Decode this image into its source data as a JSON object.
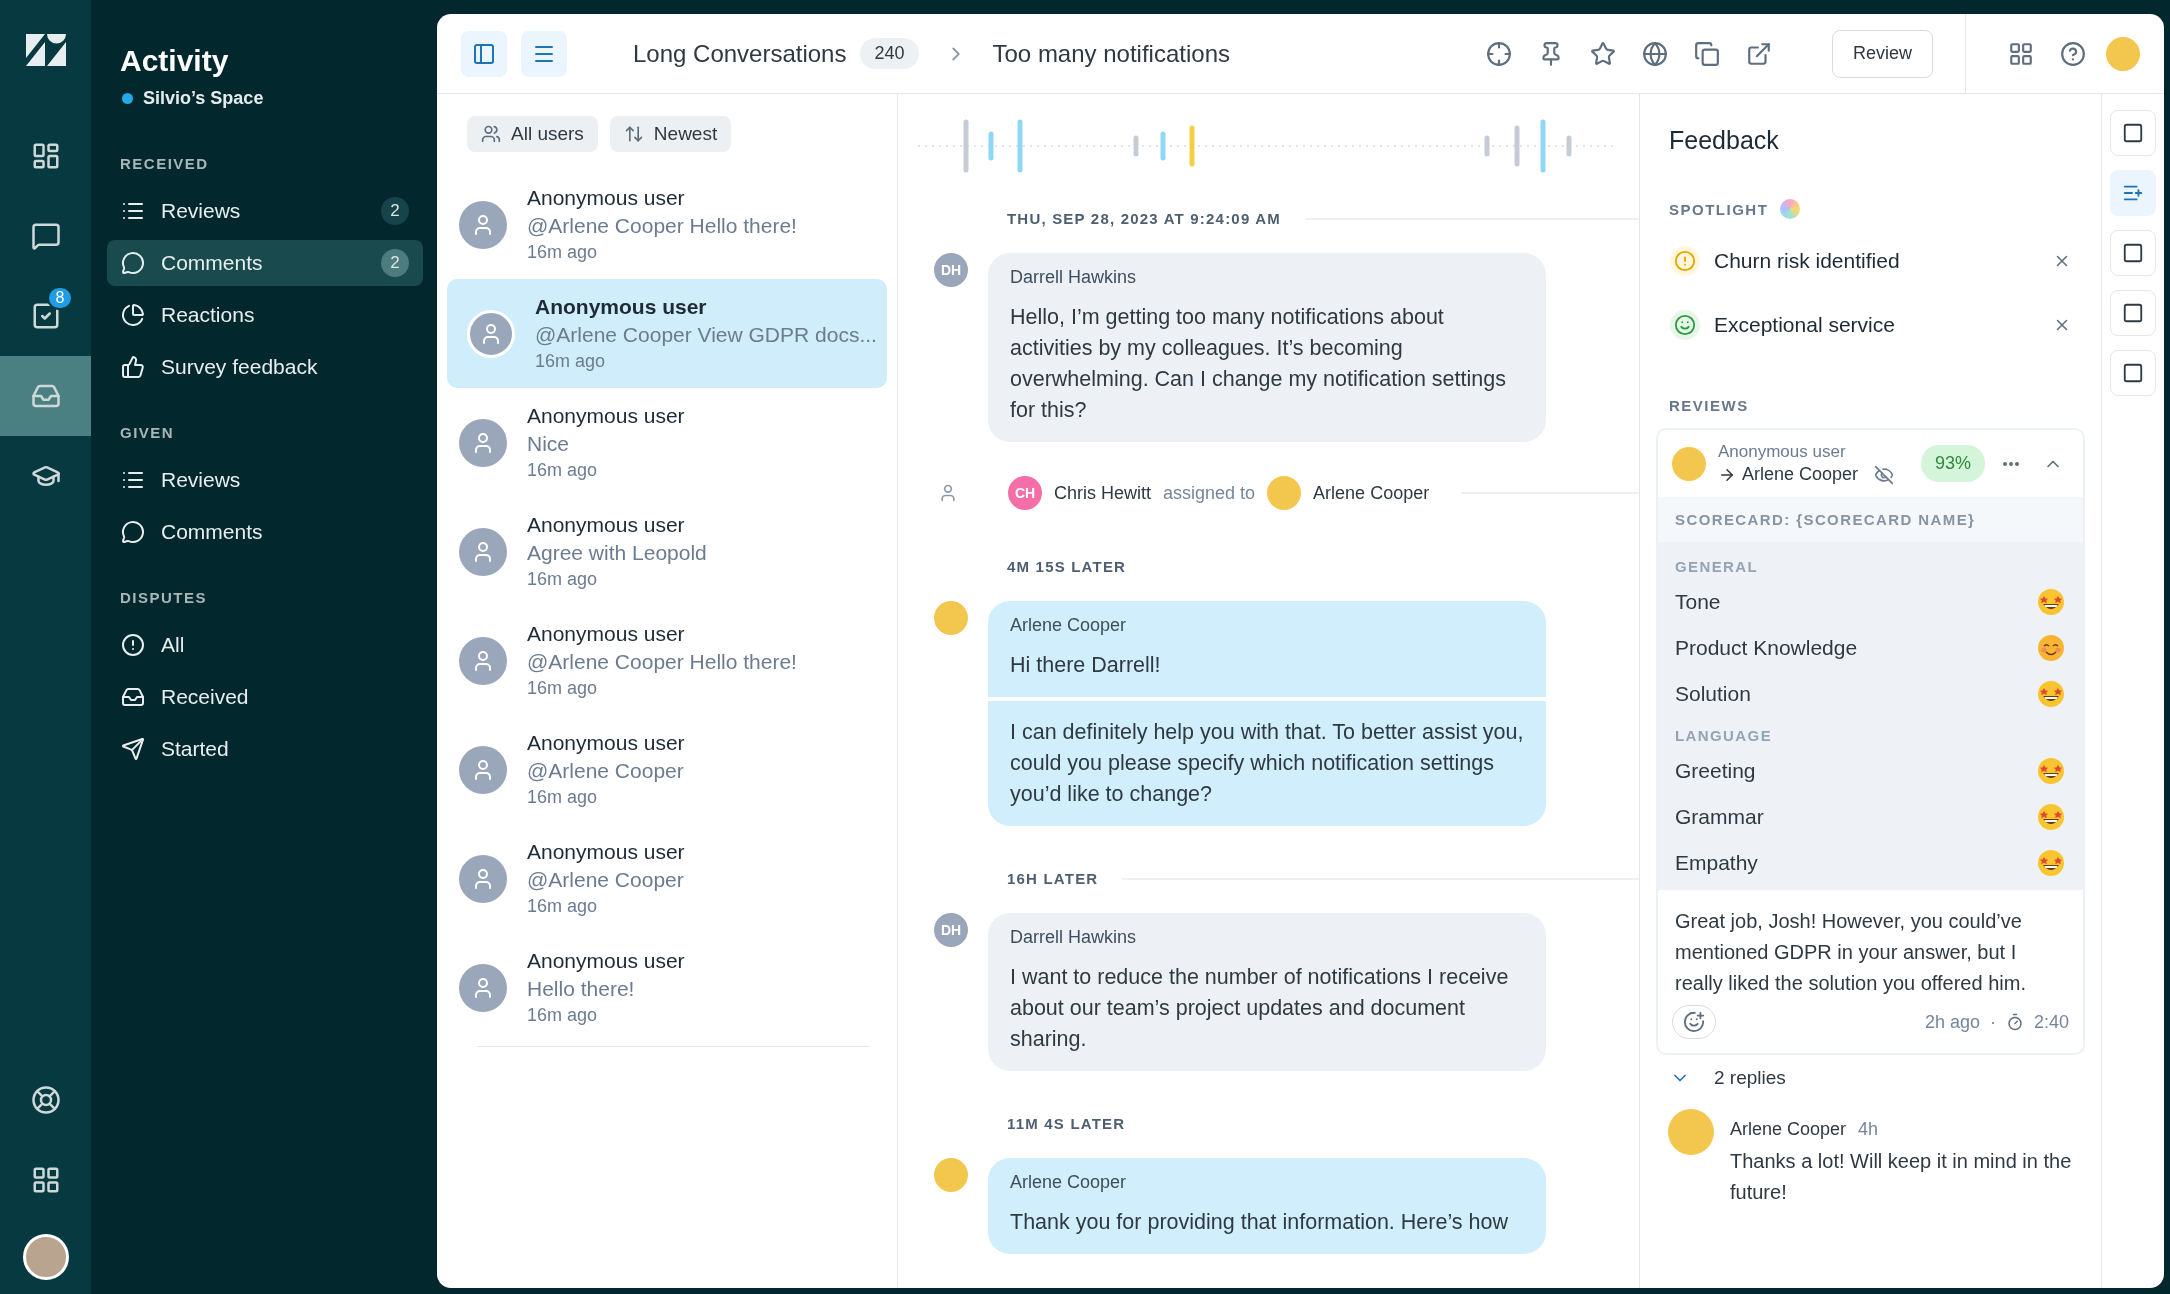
{
  "rail": {
    "top": [
      {
        "kind": "dashboard",
        "selected": false
      },
      {
        "kind": "chat",
        "selected": false
      },
      {
        "kind": "tasks",
        "selected": false,
        "badge": "8"
      },
      {
        "kind": "inbox",
        "selected": true
      },
      {
        "kind": "learn",
        "selected": false
      }
    ],
    "bottom": [
      {
        "kind": "help",
        "selected": false
      },
      {
        "kind": "apps",
        "selected": false
      }
    ]
  },
  "nav": {
    "title": "Activity",
    "space": "Silvio’s Space",
    "sections": [
      {
        "heading": "RECEIVED",
        "items": [
          {
            "kind": "reviews",
            "label": "Reviews",
            "count": "2",
            "selected": false
          },
          {
            "kind": "comments",
            "label": "Comments",
            "count": "2",
            "selected": true
          },
          {
            "kind": "reactions",
            "label": "Reactions",
            "selected": false
          },
          {
            "kind": "survey",
            "label": "Survey feedback",
            "selected": false
          }
        ]
      },
      {
        "heading": "GIVEN",
        "items": [
          {
            "kind": "reviews",
            "label": "Reviews",
            "selected": false
          },
          {
            "kind": "comments",
            "label": "Comments",
            "selected": false
          }
        ]
      },
      {
        "heading": "DISPUTES",
        "items": [
          {
            "kind": "all",
            "label": "All",
            "selected": false
          },
          {
            "kind": "received",
            "label": "Received",
            "selected": false
          },
          {
            "kind": "started",
            "label": "Started",
            "selected": false
          }
        ]
      }
    ]
  },
  "header": {
    "parent": "Long Conversations",
    "count": "240",
    "current": "Too many notifications",
    "review_button": "Review"
  },
  "filters": [
    {
      "kind": "users",
      "label": "All users"
    },
    {
      "kind": "sort",
      "label": "Newest"
    }
  ],
  "conversations": [
    {
      "name": "Anonymous user",
      "preview": "@Arlene Cooper Hello there!",
      "time": "16m ago",
      "selected": false
    },
    {
      "name": "Anonymous user",
      "preview": "@Arlene Cooper View GDPR docs...",
      "time": "16m ago",
      "selected": true
    },
    {
      "name": "Anonymous user",
      "preview": "Nice",
      "time": "16m ago",
      "selected": false
    },
    {
      "name": "Anonymous user",
      "preview": "Agree with Leopold",
      "time": "16m ago",
      "selected": false
    },
    {
      "name": "Anonymous user",
      "preview": "@Arlene Cooper Hello there!",
      "time": "16m ago",
      "selected": false
    },
    {
      "name": "Anonymous user",
      "preview": "@Arlene Cooper",
      "time": "16m ago",
      "selected": false
    },
    {
      "name": "Anonymous user",
      "preview": "@Arlene Cooper",
      "time": "16m ago",
      "selected": false
    },
    {
      "name": "Anonymous user",
      "preview": "Hello there!",
      "time": "16m ago",
      "selected": false
    }
  ],
  "chat": [
    {
      "kind": "divider",
      "label": "THU, SEP 28, 2023 AT 9:24:09 AM",
      "rule": true
    },
    {
      "kind": "customer_message",
      "author": "Darrell Hawkins",
      "initials": "DH",
      "paragraphs": [
        "Hello, I’m getting too many notifications about activities by my colleagues. It’s becoming overwhelming. Can I change my notification settings for this?"
      ]
    },
    {
      "kind": "assignment",
      "initials": "CH",
      "actor": "Chris Hewitt",
      "action": "assigned to",
      "assignee": "Arlene Cooper"
    },
    {
      "kind": "divider",
      "label": "4M 15S LATER",
      "rule": false
    },
    {
      "kind": "agent_message",
      "author": "Arlene Cooper",
      "paragraphs": [
        "Hi there Darrell!",
        "I can definitely help you with that. To better assist you, could you please specify which notification settings you’d like to change?"
      ]
    },
    {
      "kind": "divider",
      "label": "16H LATER",
      "rule": true
    },
    {
      "kind": "customer_message",
      "author": "Darrell Hawkins",
      "initials": "DH",
      "paragraphs": [
        "I want to reduce the number of notifications I receive about our team’s project updates and document sharing."
      ]
    },
    {
      "kind": "divider",
      "label": "11M 4S LATER",
      "rule": false
    },
    {
      "kind": "agent_message",
      "author": "Arlene Cooper",
      "paragraphs": [
        "Thank you for providing that information. Here’s how"
      ]
    }
  ],
  "feedback": {
    "title": "Feedback",
    "spotlight_heading": "SPOTLIGHT",
    "spotlight": [
      {
        "kind": "warning",
        "label": "Churn risk identified"
      },
      {
        "kind": "positive",
        "label": "Exceptional service"
      }
    ],
    "reviews_heading": "REVIEWS",
    "review": {
      "reviewer": "Anonymous user",
      "reviewee": "Arlene Cooper",
      "score": "93%",
      "scorecard": "SCORECARD: {SCORECARD NAME}",
      "groups": [
        {
          "name": "GENERAL",
          "criteria": [
            {
              "label": "Tone",
              "kind": "starstruck"
            },
            {
              "label": "Product Knowledge",
              "kind": "smiling"
            },
            {
              "label": "Solution",
              "kind": "starstruck"
            }
          ]
        },
        {
          "name": "LANGUAGE",
          "criteria": [
            {
              "label": "Greeting",
              "kind": "starstruck"
            },
            {
              "label": "Grammar",
              "kind": "starstruck"
            },
            {
              "label": "Empathy",
              "kind": "starstruck"
            }
          ]
        }
      ],
      "comment": "Great job, Josh! However, you could’ve mentioned GDPR in your answer, but I really liked the solution you offered him.",
      "time": "2h ago",
      "separator": "·",
      "duration": "2:40",
      "replies_label": "2 replies",
      "replies": [
        {
          "author": "Arlene Cooper",
          "time": "4h",
          "text": "Thanks a lot! Will keep it in mind in the future!"
        }
      ]
    }
  },
  "side_strip": [
    {
      "kind": "square",
      "selected": false
    },
    {
      "kind": "ai",
      "selected": true
    },
    {
      "kind": "square",
      "selected": false
    },
    {
      "kind": "square",
      "selected": false
    },
    {
      "kind": "square",
      "selected": false
    }
  ]
}
